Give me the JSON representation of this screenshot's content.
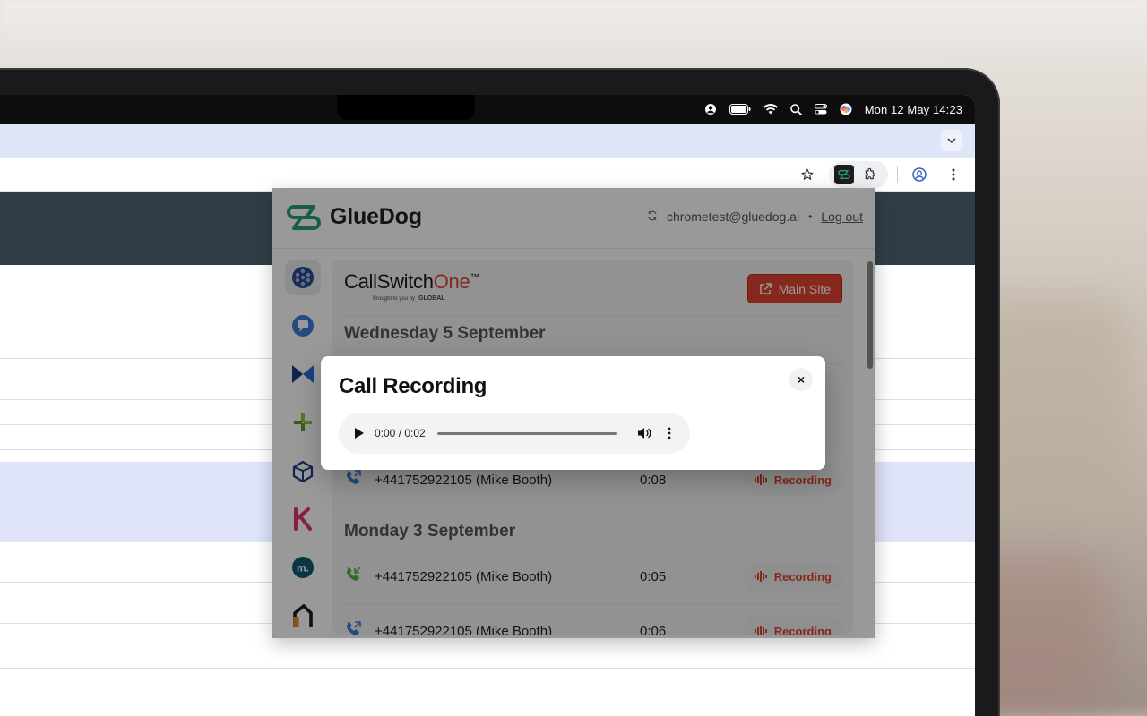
{
  "menubar": {
    "clock": "Mon 12 May  14:23",
    "icons": [
      "user-icon",
      "battery-icon",
      "wifi-icon",
      "search-icon",
      "control-center-icon",
      "siri-icon"
    ]
  },
  "browser": {
    "toolbar_icons": [
      "star-icon",
      "gluedog-extension-icon",
      "extensions-puzzle-icon",
      "profile-icon",
      "menu-kebab-icon"
    ]
  },
  "popup": {
    "brand": "GlueDog",
    "account_email": "chrometest@gluedog.ai",
    "separator": "•",
    "logout_label": "Log out",
    "rail_apps": [
      "app-circles",
      "app-chat",
      "app-bow",
      "app-plus",
      "app-cube",
      "app-k",
      "app-m",
      "app-n"
    ],
    "cs_brand_main": "CallSwitch",
    "cs_brand_accent": "One",
    "cs_brand_tm": "™",
    "cs_brand_sub": "Brought to you by",
    "cs_brand_sub2": "GLOBAL",
    "main_site_label": "Main Site",
    "days": [
      {
        "label": "Wednesday 5 September"
      },
      {
        "label": "Monday 3 September"
      }
    ],
    "calls": [
      {
        "number": "+441752922105 (Mike Booth)",
        "duration": "0:08",
        "action": "Recording",
        "direction": "outgoing"
      },
      {
        "number": "+441752922105 (Mike Booth)",
        "duration": "0:05",
        "action": "Recording",
        "direction": "incoming"
      },
      {
        "number": "+441752922105 (Mike Booth)",
        "duration": "0:06",
        "action": "Recording",
        "direction": "outgoing"
      }
    ]
  },
  "modal": {
    "title": "Call Recording",
    "close_glyph": "×",
    "player_time": "0:00 / 0:02",
    "progress": 0
  },
  "colors": {
    "accent_red": "#e0432d",
    "gluedog_green": "#2a9d7c",
    "header_slate": "#2f3e46"
  }
}
